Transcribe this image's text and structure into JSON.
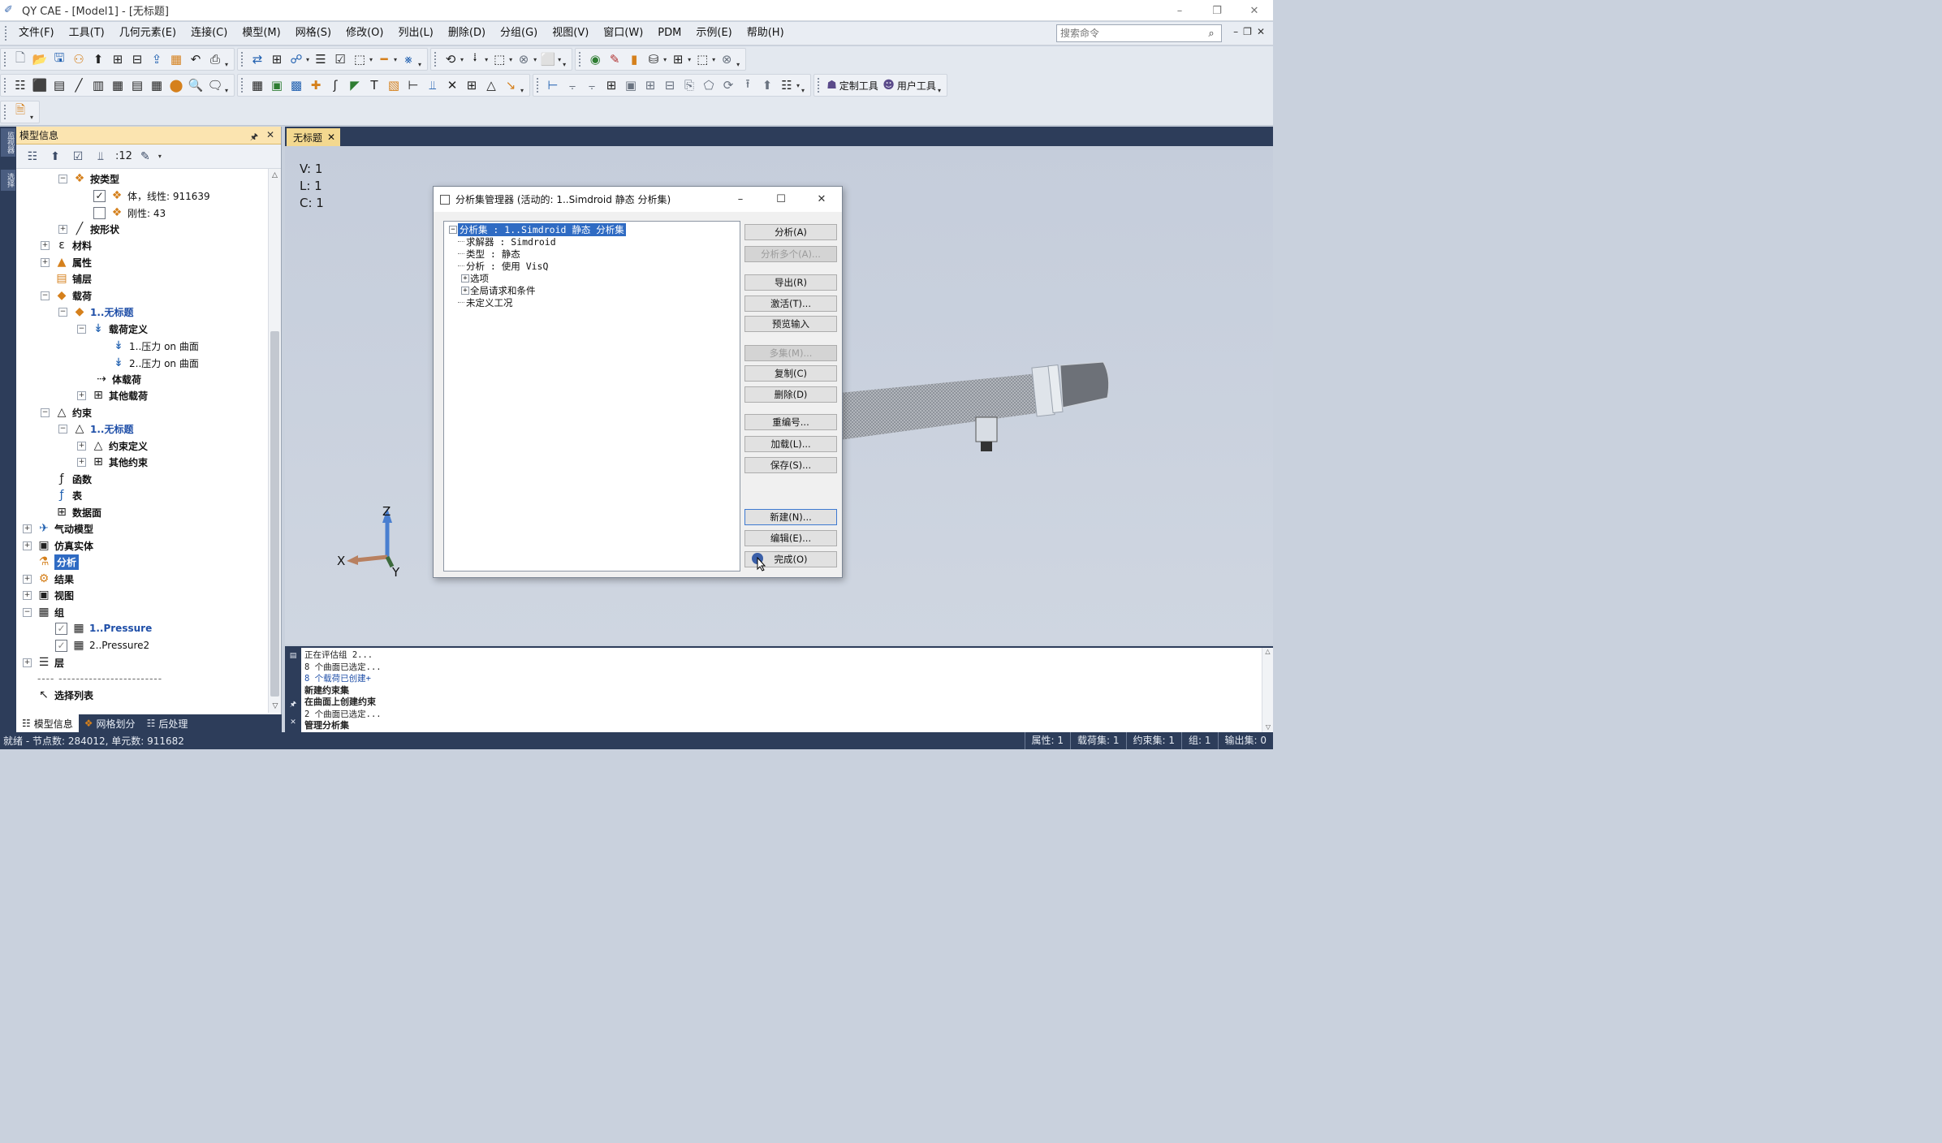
{
  "window": {
    "title": "QY CAE - [Model1] - [无标题]",
    "controls": [
      "minimize",
      "restore",
      "close"
    ]
  },
  "menubar": {
    "items": [
      "文件(F)",
      "工具(T)",
      "几何元素(E)",
      "连接(C)",
      "模型(M)",
      "网格(S)",
      "修改(O)",
      "列出(L)",
      "删除(D)",
      "分组(G)",
      "视图(V)",
      "窗口(W)",
      "PDM",
      "示例(E)",
      "帮助(H)"
    ],
    "search_placeholder": "搜索命令"
  },
  "toolbar2": {
    "custom_tools": "定制工具",
    "user_tools": "用户工具"
  },
  "left_strip": {
    "tabs": [
      "监视器",
      "选择"
    ]
  },
  "panel": {
    "title": "模型信息",
    "toolbar_level": ":12",
    "tree": [
      {
        "label": "按类型",
        "style": "bold"
      },
      {
        "label": "体，线性: 911639",
        "checked": true
      },
      {
        "label": "刚性: 43",
        "checked": false
      },
      {
        "label": "按形状",
        "style": "bold"
      },
      {
        "label": "材料",
        "style": "bold"
      },
      {
        "label": "属性",
        "style": "bold"
      },
      {
        "label": "铺层",
        "style": "bold"
      },
      {
        "label": "载荷",
        "style": "bold"
      },
      {
        "label": "1..无标题",
        "style": "blue"
      },
      {
        "label": "载荷定义",
        "style": "bold"
      },
      {
        "label": "1..压力 on 曲面"
      },
      {
        "label": "2..压力 on 曲面"
      },
      {
        "label": "体载荷",
        "style": "bold"
      },
      {
        "label": "其他载荷",
        "style": "bold"
      },
      {
        "label": "约束",
        "style": "bold"
      },
      {
        "label": "1..无标题",
        "style": "blue"
      },
      {
        "label": "约束定义",
        "style": "bold"
      },
      {
        "label": "其他约束",
        "style": "bold"
      },
      {
        "label": "函数",
        "style": "bold"
      },
      {
        "label": "表",
        "style": "bold"
      },
      {
        "label": "数据面",
        "style": "bold"
      },
      {
        "label": "气动模型",
        "style": "bold"
      },
      {
        "label": "仿真实体",
        "style": "bold"
      },
      {
        "label": "分析",
        "style": "selected"
      },
      {
        "label": "结果",
        "style": "bold"
      },
      {
        "label": "视图",
        "style": "bold"
      },
      {
        "label": "组",
        "style": "bold"
      },
      {
        "label": "1..Pressure",
        "style": "blue"
      },
      {
        "label": "2..Pressure2"
      },
      {
        "label": "层",
        "style": "bold"
      },
      {
        "label": "---- ------------------------"
      },
      {
        "label": "选择列表",
        "style": "bold"
      }
    ],
    "tabs": [
      "模型信息",
      "网格划分",
      "后处理"
    ]
  },
  "document_tab": "无标题",
  "viewport": {
    "counters": [
      "V: 1",
      "L: 1",
      "C: 1"
    ],
    "axes": {
      "x": "X",
      "y": "Y",
      "z": "Z"
    }
  },
  "dialog": {
    "title": "分析集管理器 (活动的: 1..Simdroid 静态 分析集)",
    "tree": [
      "分析集 : 1..Simdroid 静态 分析集",
      "求解器 : Simdroid",
      "类型 : 静态",
      "分析 : 使用 VisQ",
      "选项",
      "全局请求和条件",
      "未定义工况"
    ],
    "buttons": {
      "analyze": "分析(A)",
      "analyze_multiple": "分析多个(A)...",
      "export": "导出(R)",
      "activate": "激活(T)...",
      "preview_input": "预览输入",
      "multi_set": "多集(M)...",
      "copy": "复制(C)",
      "delete": "删除(D)",
      "renumber": "重编号...",
      "load": "加载(L)...",
      "save": "保存(S)...",
      "new": "新建(N)...",
      "edit": "编辑(E)...",
      "done": "完成(O)"
    }
  },
  "output": {
    "lines": [
      {
        "text": "正在评估组 2...",
        "style": "normal"
      },
      {
        "text": "8 个曲面已选定...",
        "style": "normal"
      },
      {
        "text": "8 个载荷已创建+",
        "style": "blue"
      },
      {
        "text": "新建约束集",
        "style": "bold"
      },
      {
        "text": "在曲面上创建约束",
        "style": "bold"
      },
      {
        "text": "2 个曲面已选定...",
        "style": "normal"
      },
      {
        "text": "管理分析集",
        "style": "bold"
      }
    ]
  },
  "statusbar": {
    "left": "就绪 - 节点数: 284012, 单元数: 911682",
    "cells": [
      "属性: 1",
      "载荷集: 1",
      "约束集: 1",
      "组: 1",
      "输出集: 0"
    ]
  },
  "colors": {
    "panel_header": "#fbe4b0",
    "dark_frame": "#2d3d5a",
    "selection": "#2f6bc3",
    "viewport_bg": "#c9d1dd"
  }
}
